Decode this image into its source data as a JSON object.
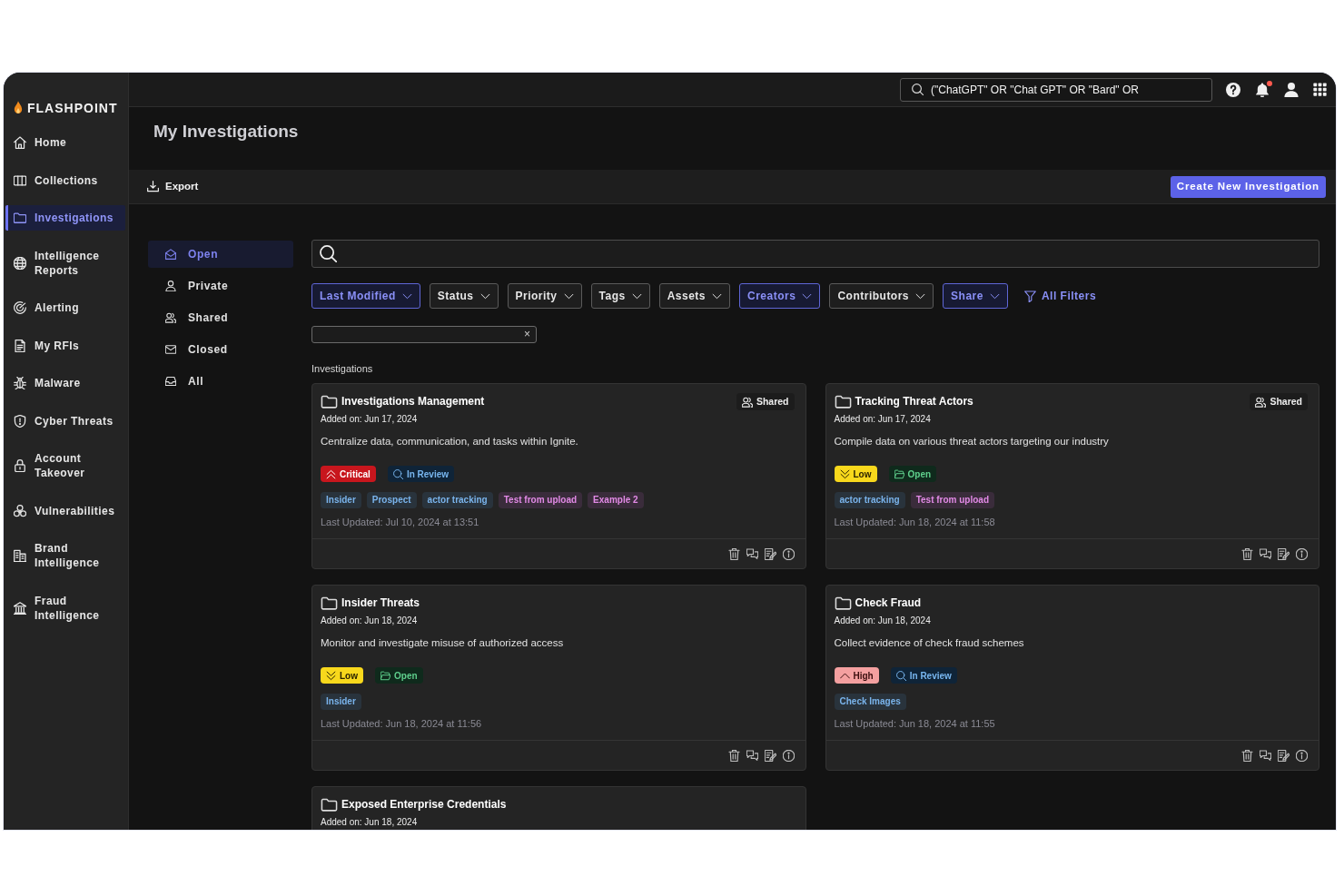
{
  "sidebar": {
    "logo": "FLASHPOINT",
    "items": [
      {
        "label": "Home",
        "selected": false
      },
      {
        "label": "Collections",
        "selected": false
      },
      {
        "label": "Investigations",
        "selected": true
      },
      {
        "label": "Intelligence Reports",
        "selected": false
      },
      {
        "label": "Alerting",
        "selected": false
      },
      {
        "label": "My RFIs",
        "selected": false
      },
      {
        "label": "Malware",
        "selected": false
      },
      {
        "label": "Cyber Threats",
        "selected": false
      },
      {
        "label": "Account Takeover",
        "selected": false
      },
      {
        "label": "Vulnerabilities",
        "selected": false
      },
      {
        "label": "Brand Intelligence",
        "selected": false
      },
      {
        "label": "Fraud Intelligence",
        "selected": false
      }
    ]
  },
  "top_bar": {
    "search_value": "(\"ChatGPT\" OR \"Chat GPT\" OR \"Bard\" OR",
    "notifications_unread": true
  },
  "header": {
    "title": "My Investigations"
  },
  "toolbar": {
    "export": "Export",
    "create_button": "Create New Investigation"
  },
  "views": [
    {
      "label": "Open",
      "selected": true
    },
    {
      "label": "Private",
      "selected": false
    },
    {
      "label": "Shared",
      "selected": false
    },
    {
      "label": "Closed",
      "selected": false
    },
    {
      "label": "All",
      "selected": false
    }
  ],
  "filters": [
    {
      "label": "Last Modified",
      "active": true
    },
    {
      "label": "Status",
      "active": false
    },
    {
      "label": "Priority",
      "active": false
    },
    {
      "label": "Tags",
      "active": false
    },
    {
      "label": "Assets",
      "active": false
    },
    {
      "label": "Creators",
      "active": true
    },
    {
      "label": "Contributors",
      "active": false
    },
    {
      "label": "Share",
      "active": true
    }
  ],
  "all_filters": "All Filters",
  "filter_input": {
    "clear": "×"
  },
  "section_label": "Investigations",
  "investigations": [
    {
      "title": "Investigations Management",
      "shared_label": "Shared",
      "added": "Added on: Jun 17, 2024",
      "description": "Centralize data, communication, and tasks within Ignite.",
      "priority": {
        "kind": "critical",
        "label": "Critical"
      },
      "status": {
        "kind": "in_review",
        "label": "In Review"
      },
      "tags": [
        {
          "label": "Insider",
          "color": "#7ab4ec"
        },
        {
          "label": "Prospect",
          "color": "#7ab4ec"
        },
        {
          "label": "actor tracking",
          "color": "#7ab4ec"
        },
        {
          "label": "Test from upload",
          "color": "#e28ae6"
        },
        {
          "label": "Example 2",
          "color": "#e28ae6"
        }
      ],
      "updated": "Last Updated: Jul 10, 2024 at 13:51"
    },
    {
      "title": "Tracking Threat Actors",
      "shared_label": "Shared",
      "added": "Added on: Jun 17, 2024",
      "description": "Compile data on various threat actors targeting our industry",
      "priority": {
        "kind": "low",
        "label": "Low"
      },
      "status": {
        "kind": "open",
        "label": "Open"
      },
      "tags": [
        {
          "label": "actor tracking",
          "color": "#7ab4ec"
        },
        {
          "label": "Test from upload",
          "color": "#e28ae6"
        }
      ],
      "updated": "Last Updated: Jun 18, 2024 at 11:58"
    },
    {
      "title": "Insider Threats",
      "added": "Added on: Jun 18, 2024",
      "description": "Monitor and investigate misuse of authorized access",
      "priority": {
        "kind": "low",
        "label": "Low"
      },
      "status": {
        "kind": "open",
        "label": "Open"
      },
      "tags": [
        {
          "label": "Insider",
          "color": "#7ab4ec"
        }
      ],
      "updated": "Last Updated: Jun 18, 2024 at 11:56"
    },
    {
      "title": "Check Fraud",
      "added": "Added on: Jun 18, 2024",
      "description": "Collect evidence of check fraud schemes",
      "priority": {
        "kind": "high",
        "label": "High"
      },
      "status": {
        "kind": "in_review",
        "label": "In Review"
      },
      "tags": [
        {
          "label": "Check Images",
          "color": "#7ab4ec"
        }
      ],
      "updated": "Last Updated: Jun 18, 2024 at 11:55"
    },
    {
      "title": "Exposed Enterprise Credentials",
      "added": "Added on: Jun 18, 2024"
    }
  ]
}
